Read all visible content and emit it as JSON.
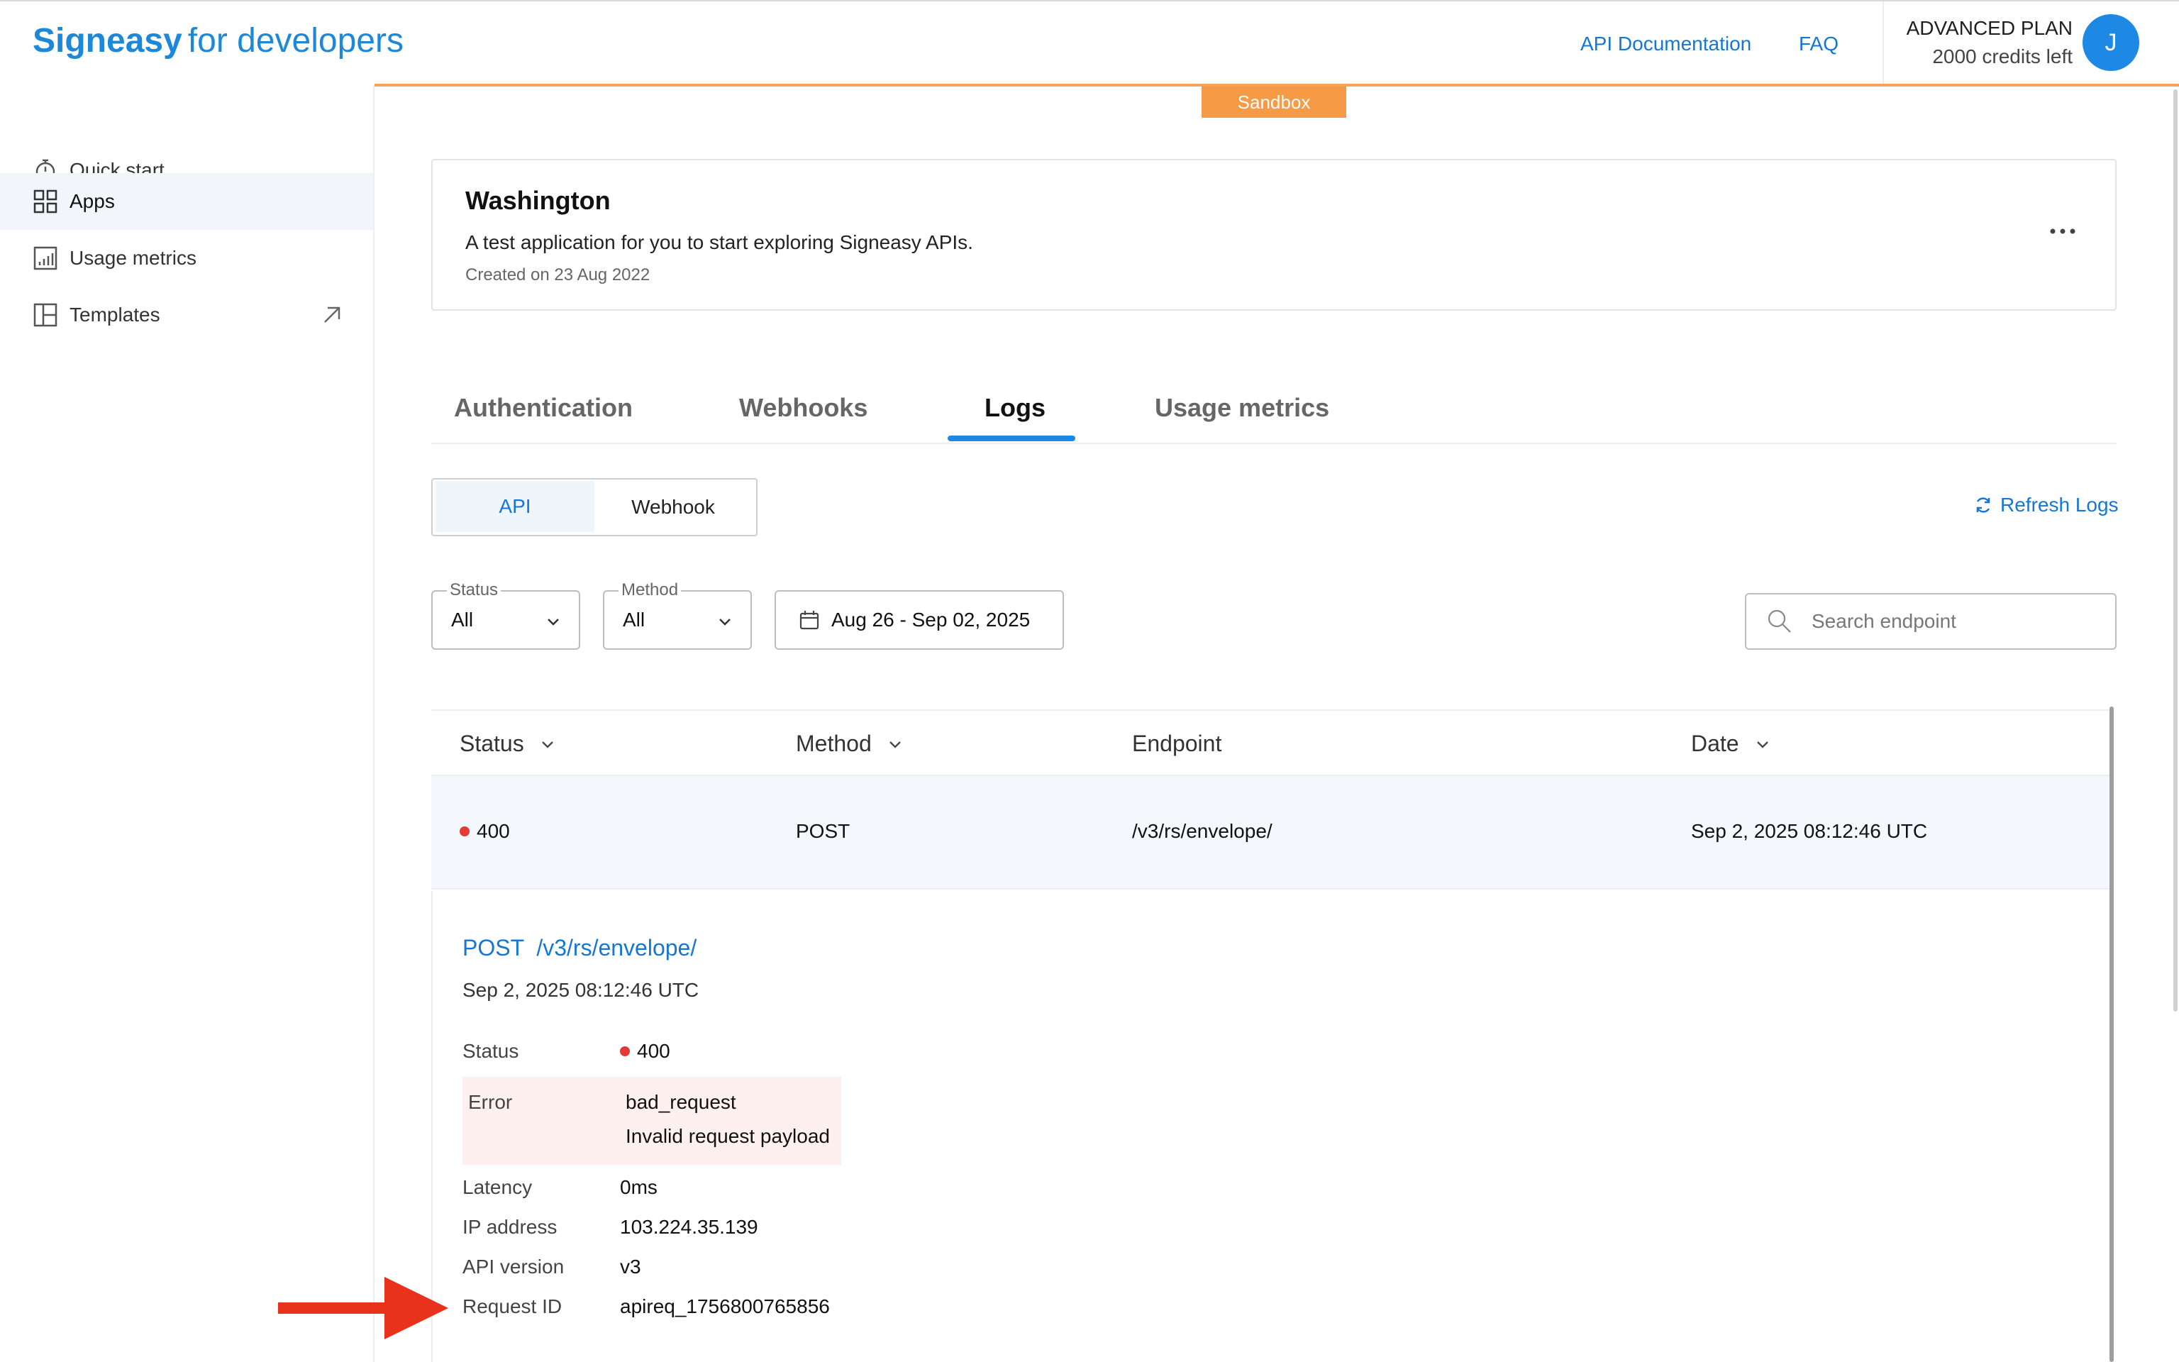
{
  "header": {
    "brand": "Signeasy",
    "brand_suffix": "for developers",
    "links": {
      "api_docs": "API Documentation",
      "faq": "FAQ"
    },
    "plan": {
      "name": "ADVANCED PLAN",
      "credits": "2000 credits left"
    },
    "avatar_initial": "J",
    "environment_badge": "Sandbox"
  },
  "sidebar": {
    "items": [
      {
        "label": "Quick start",
        "icon": "timer-icon"
      },
      {
        "label": "Apps",
        "icon": "grid-icon",
        "active": true
      },
      {
        "label": "Usage metrics",
        "icon": "bar-chart-icon"
      },
      {
        "label": "Templates",
        "icon": "template-icon",
        "external": true
      }
    ]
  },
  "app": {
    "name": "Washington",
    "description": "A test application for you to start exploring Signeasy APIs.",
    "created": "Created on 23 Aug 2022"
  },
  "tabs": [
    {
      "label": "Authentication"
    },
    {
      "label": "Webhooks"
    },
    {
      "label": "Logs",
      "active": true
    },
    {
      "label": "Usage metrics"
    }
  ],
  "log_type": {
    "api": "API",
    "webhook": "Webhook",
    "selected": "API"
  },
  "refresh_label": "Refresh Logs",
  "filters": {
    "status": {
      "label": "Status",
      "value": "All"
    },
    "method": {
      "label": "Method",
      "value": "All"
    },
    "date_range": "Aug 26 - Sep 02, 2025",
    "search_placeholder": "Search endpoint"
  },
  "table": {
    "columns": {
      "status": "Status",
      "method": "Method",
      "endpoint": "Endpoint",
      "date": "Date"
    },
    "rows": [
      {
        "status": "400",
        "method": "POST",
        "endpoint": "/v3/rs/envelope/",
        "date": "Sep 2, 2025 08:12:46 UTC"
      }
    ]
  },
  "detail": {
    "title": "POST  /v3/rs/envelope/",
    "date": "Sep 2, 2025 08:12:46 UTC",
    "status_label": "Status",
    "status_value": "400",
    "error_label": "Error",
    "error_code": "bad_request",
    "error_message": "Invalid request payload",
    "latency_label": "Latency",
    "latency_value": "0ms",
    "ip_label": "IP address",
    "ip_value": "103.224.35.139",
    "api_version_label": "API version",
    "api_version_value": "v3",
    "request_id_label": "Request ID",
    "request_id_value": "apireq_1756800765856"
  },
  "colors": {
    "brand": "#1e88d8",
    "link": "#1677d2",
    "sandbox": "#f79a45",
    "error_dot": "#e53935",
    "annotation_arrow": "#e8321c"
  }
}
